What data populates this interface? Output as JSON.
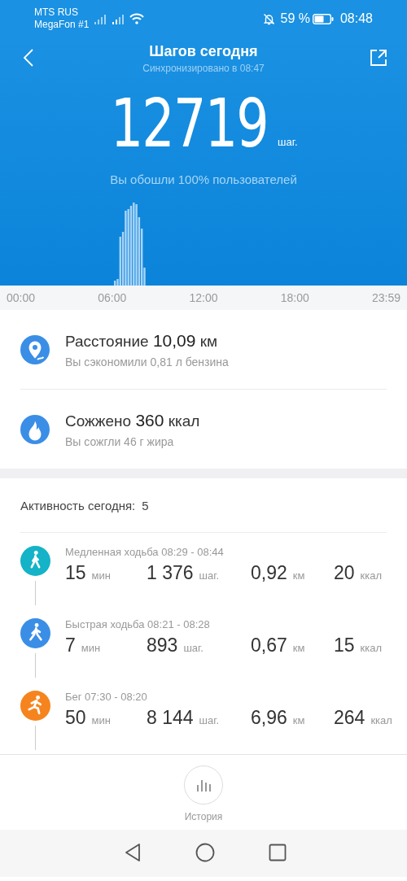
{
  "status_bar": {
    "carriers": [
      "MTS RUS",
      "MegaFon #1"
    ],
    "battery": "59 %",
    "time": "08:48"
  },
  "header": {
    "title": "Шагов сегодня",
    "subtitle": "Синхронизировано в 08:47"
  },
  "steps": {
    "value": "12719",
    "unit": "шаг.",
    "caption": "Вы обошли 100% пользователей"
  },
  "time_axis": [
    "00:00",
    "06:00",
    "12:00",
    "18:00",
    "23:59"
  ],
  "summary": [
    {
      "kind": "distance",
      "title": "Расстояние **10,09** км",
      "note": "Вы сэкономили 0,81 л бензина"
    },
    {
      "kind": "calories",
      "title": "Сожжено **360** ккал",
      "note": "Вы сожгли 46 г жира"
    }
  ],
  "activity": {
    "title": "Активность сегодня:",
    "count": "5",
    "items": [
      {
        "kind": "walk",
        "color": "#14b3c7",
        "title": "Медленная ходьба 08:29 - 08:44",
        "stats": [
          {
            "value": "15",
            "unit": "мин"
          },
          {
            "value": "1 376",
            "unit": "шаг."
          },
          {
            "value": "0,92",
            "unit": "км"
          },
          {
            "value": "20",
            "unit": "ккал"
          }
        ]
      },
      {
        "kind": "brisk",
        "color": "#3a8ee6",
        "title": "Быстрая ходьба 08:21 - 08:28",
        "stats": [
          {
            "value": "7",
            "unit": "мин"
          },
          {
            "value": "893",
            "unit": "шаг."
          },
          {
            "value": "0,67",
            "unit": "км"
          },
          {
            "value": "15",
            "unit": "ккал"
          }
        ]
      },
      {
        "kind": "run",
        "color": "#f5841f",
        "title": "Бег 07:30 - 08:20",
        "stats": [
          {
            "value": "50",
            "unit": "мин"
          },
          {
            "value": "8 144",
            "unit": "шаг."
          },
          {
            "value": "6,96",
            "unit": "км"
          },
          {
            "value": "264",
            "unit": "ккал"
          }
        ]
      }
    ]
  },
  "history": {
    "label": "История"
  }
}
